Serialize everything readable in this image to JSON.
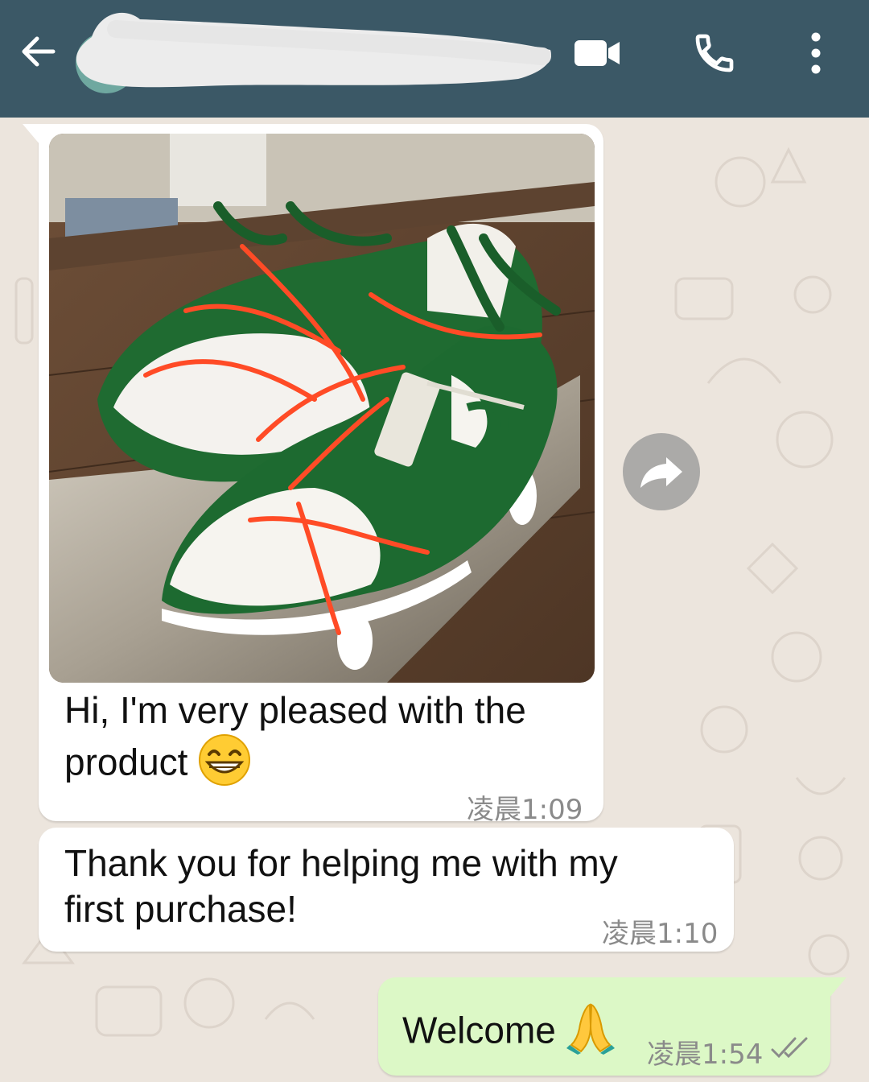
{
  "header": {
    "contact_name": "",
    "bg_color": "#3b5866"
  },
  "icons": {
    "back": "arrow-left",
    "video": "video-camera",
    "call": "phone",
    "menu": "vertical-dots",
    "forward": "forward-arrow",
    "read_receipt": "double-check"
  },
  "messages": [
    {
      "direction": "incoming",
      "attachment": "photo of green and white sneakers with orange laces on a shoebox",
      "text": "Hi, I'm very pleased with the product",
      "emoji": "grinning-face-with-smiling-eyes",
      "time": "凌晨1:09"
    },
    {
      "direction": "incoming",
      "text_line1": "Thank you for helping me with my",
      "text_line2": "first purchase!",
      "time": "凌晨1:10"
    },
    {
      "direction": "outgoing",
      "text": "Welcome",
      "emoji": "folded-hands",
      "time": "凌晨1:54"
    }
  ],
  "colors": {
    "chat_bg": "#ece5dd",
    "incoming_bubble": "#ffffff",
    "outgoing_bubble": "#dcf8c6"
  }
}
